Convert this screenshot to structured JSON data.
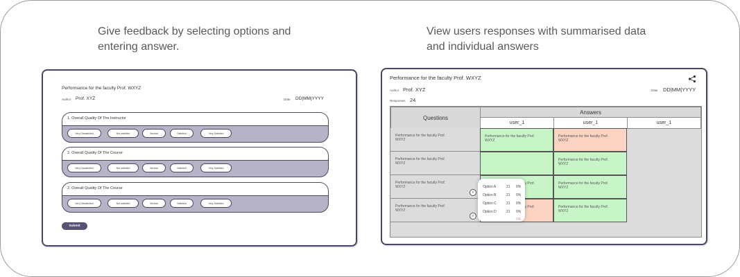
{
  "captions": {
    "left": "Give feedback by selecting options and entering answer.",
    "right": "View users responses with summarised data and individual answers"
  },
  "form": {
    "title": "Performance for the faculty  Prof.  WXYZ",
    "author_label": "Author",
    "author": "Prof. XYZ",
    "date_label": "Date",
    "date": "DD|MM|YYYY",
    "questions": [
      {
        "text": "1. Overall Quality Of The Instructor",
        "options": [
          "Very Dissatisfied",
          "Not satisfied",
          "Neutral",
          "Satisfied",
          "Very Satisfied"
        ]
      },
      {
        "text": "2. Overall Quality Of The Course",
        "options": [
          "Very Dissatisfied",
          "Not satisfied",
          "Neutral",
          "Satisfied",
          "Very Satisfied"
        ]
      },
      {
        "text": "2. Overall Quality Of The Course",
        "options": [
          "Very Dissatisfied",
          "Not satisfied",
          "Neutral",
          "Satisfied",
          "Very Satisfied"
        ]
      }
    ],
    "submit": "Submit"
  },
  "dashboard": {
    "title": "Performance for the faculty  Prof.  WXYZ",
    "author_label": "Author",
    "author": "Prof. XYZ",
    "date_label": "Date",
    "date": "DD|MM|YYYY",
    "responses_label": "Responses",
    "responses": "24",
    "questions_header": "Questions",
    "answers_header": "Answers",
    "user_columns": [
      "user_1",
      "user_1",
      "user_1"
    ],
    "rows": [
      {
        "question": "Performance for the faculty  Prof.  WXYZ",
        "answers": [
          "Performance for the faculty  Prof.  WXYZ",
          "Performance for the faculty  Prof.  WXYZ"
        ],
        "colors": [
          "green",
          "peach"
        ],
        "icon": false
      },
      {
        "question": "Performance for the faculty  Prof.  WXYZ",
        "answers": [
          "",
          "Performance for the faculty  Prof.  WXYZ"
        ],
        "colors": [
          "green",
          "green"
        ],
        "icon": false
      },
      {
        "question": "Performance for the faculty  Prof.  WXYZ",
        "answers": [
          "Performance for the faculty  Prof.  WXYZ",
          "Performance for the faculty  Prof.  WXYZ"
        ],
        "colors": [
          "green",
          "green"
        ],
        "icon": true
      },
      {
        "question": "Performance for the faculty  Prof.  WXYZ",
        "answers": [
          "Performance for the faculty  Prof.  WXYZ",
          "Performance for the faculty  Prof.  WXYZ"
        ],
        "colors": [
          "peach",
          "green"
        ],
        "icon": true
      }
    ],
    "popup": [
      {
        "label": "Option A",
        "count": "21",
        "pct": "0%"
      },
      {
        "label": "Option B",
        "count": "21",
        "pct": "0%"
      },
      {
        "label": "Option C",
        "count": "21",
        "pct": "0%"
      },
      {
        "label": "Option D",
        "count": "21",
        "pct": "0%"
      }
    ],
    "popup_extra": "0%",
    "icons": {
      "share": "share-icon",
      "note": "note-icon"
    }
  },
  "colors": {
    "frame": "#4a4560",
    "card": "#b7b3c7",
    "green": "#c8f5c8",
    "peach": "#fbd3c2",
    "submit": "#5a5276"
  }
}
